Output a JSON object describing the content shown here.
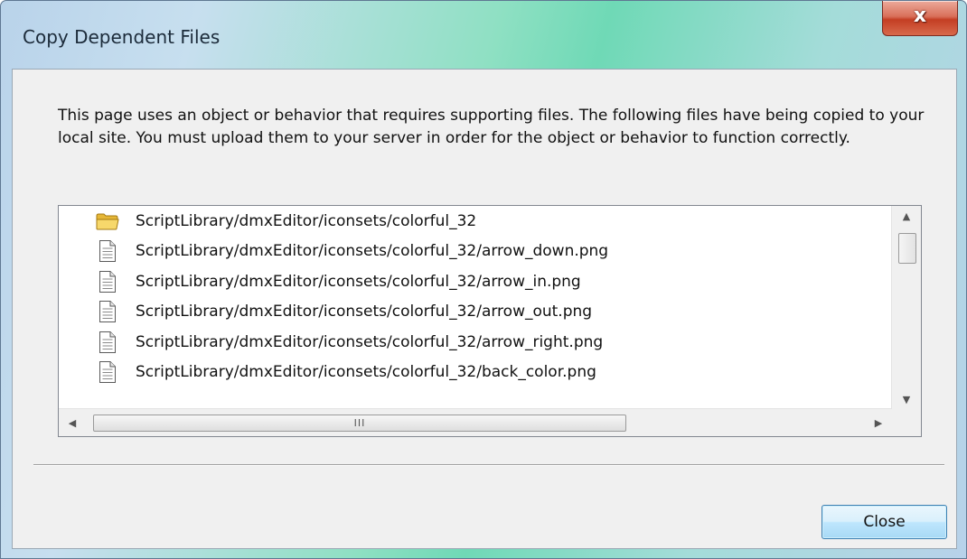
{
  "window": {
    "title": "Copy Dependent Files",
    "close_glyph": "x"
  },
  "message": "This page uses an object or behavior that requires supporting files. The following files have being copied to your local site. You must upload them to your server in order for the object or behavior to function correctly.",
  "files": [
    {
      "icon": "folder-icon",
      "path": "ScriptLibrary/dmxEditor/iconsets/colorful_32"
    },
    {
      "icon": "file-icon",
      "path": "ScriptLibrary/dmxEditor/iconsets/colorful_32/arrow_down.png"
    },
    {
      "icon": "file-icon",
      "path": "ScriptLibrary/dmxEditor/iconsets/colorful_32/arrow_in.png"
    },
    {
      "icon": "file-icon",
      "path": "ScriptLibrary/dmxEditor/iconsets/colorful_32/arrow_out.png"
    },
    {
      "icon": "file-icon",
      "path": "ScriptLibrary/dmxEditor/iconsets/colorful_32/arrow_right.png"
    },
    {
      "icon": "file-icon",
      "path": "ScriptLibrary/dmxEditor/iconsets/colorful_32/back_color.png"
    }
  ],
  "scrollbar": {
    "up_glyph": "▲",
    "down_glyph": "▼",
    "left_glyph": "◀",
    "right_glyph": "▶",
    "grip_glyph": "III"
  },
  "buttons": {
    "close_label": "Close"
  },
  "colors": {
    "button_border": "#3c7fb1",
    "close_button_red": "#c43e23",
    "folder_yellow": "#f2c94c"
  }
}
